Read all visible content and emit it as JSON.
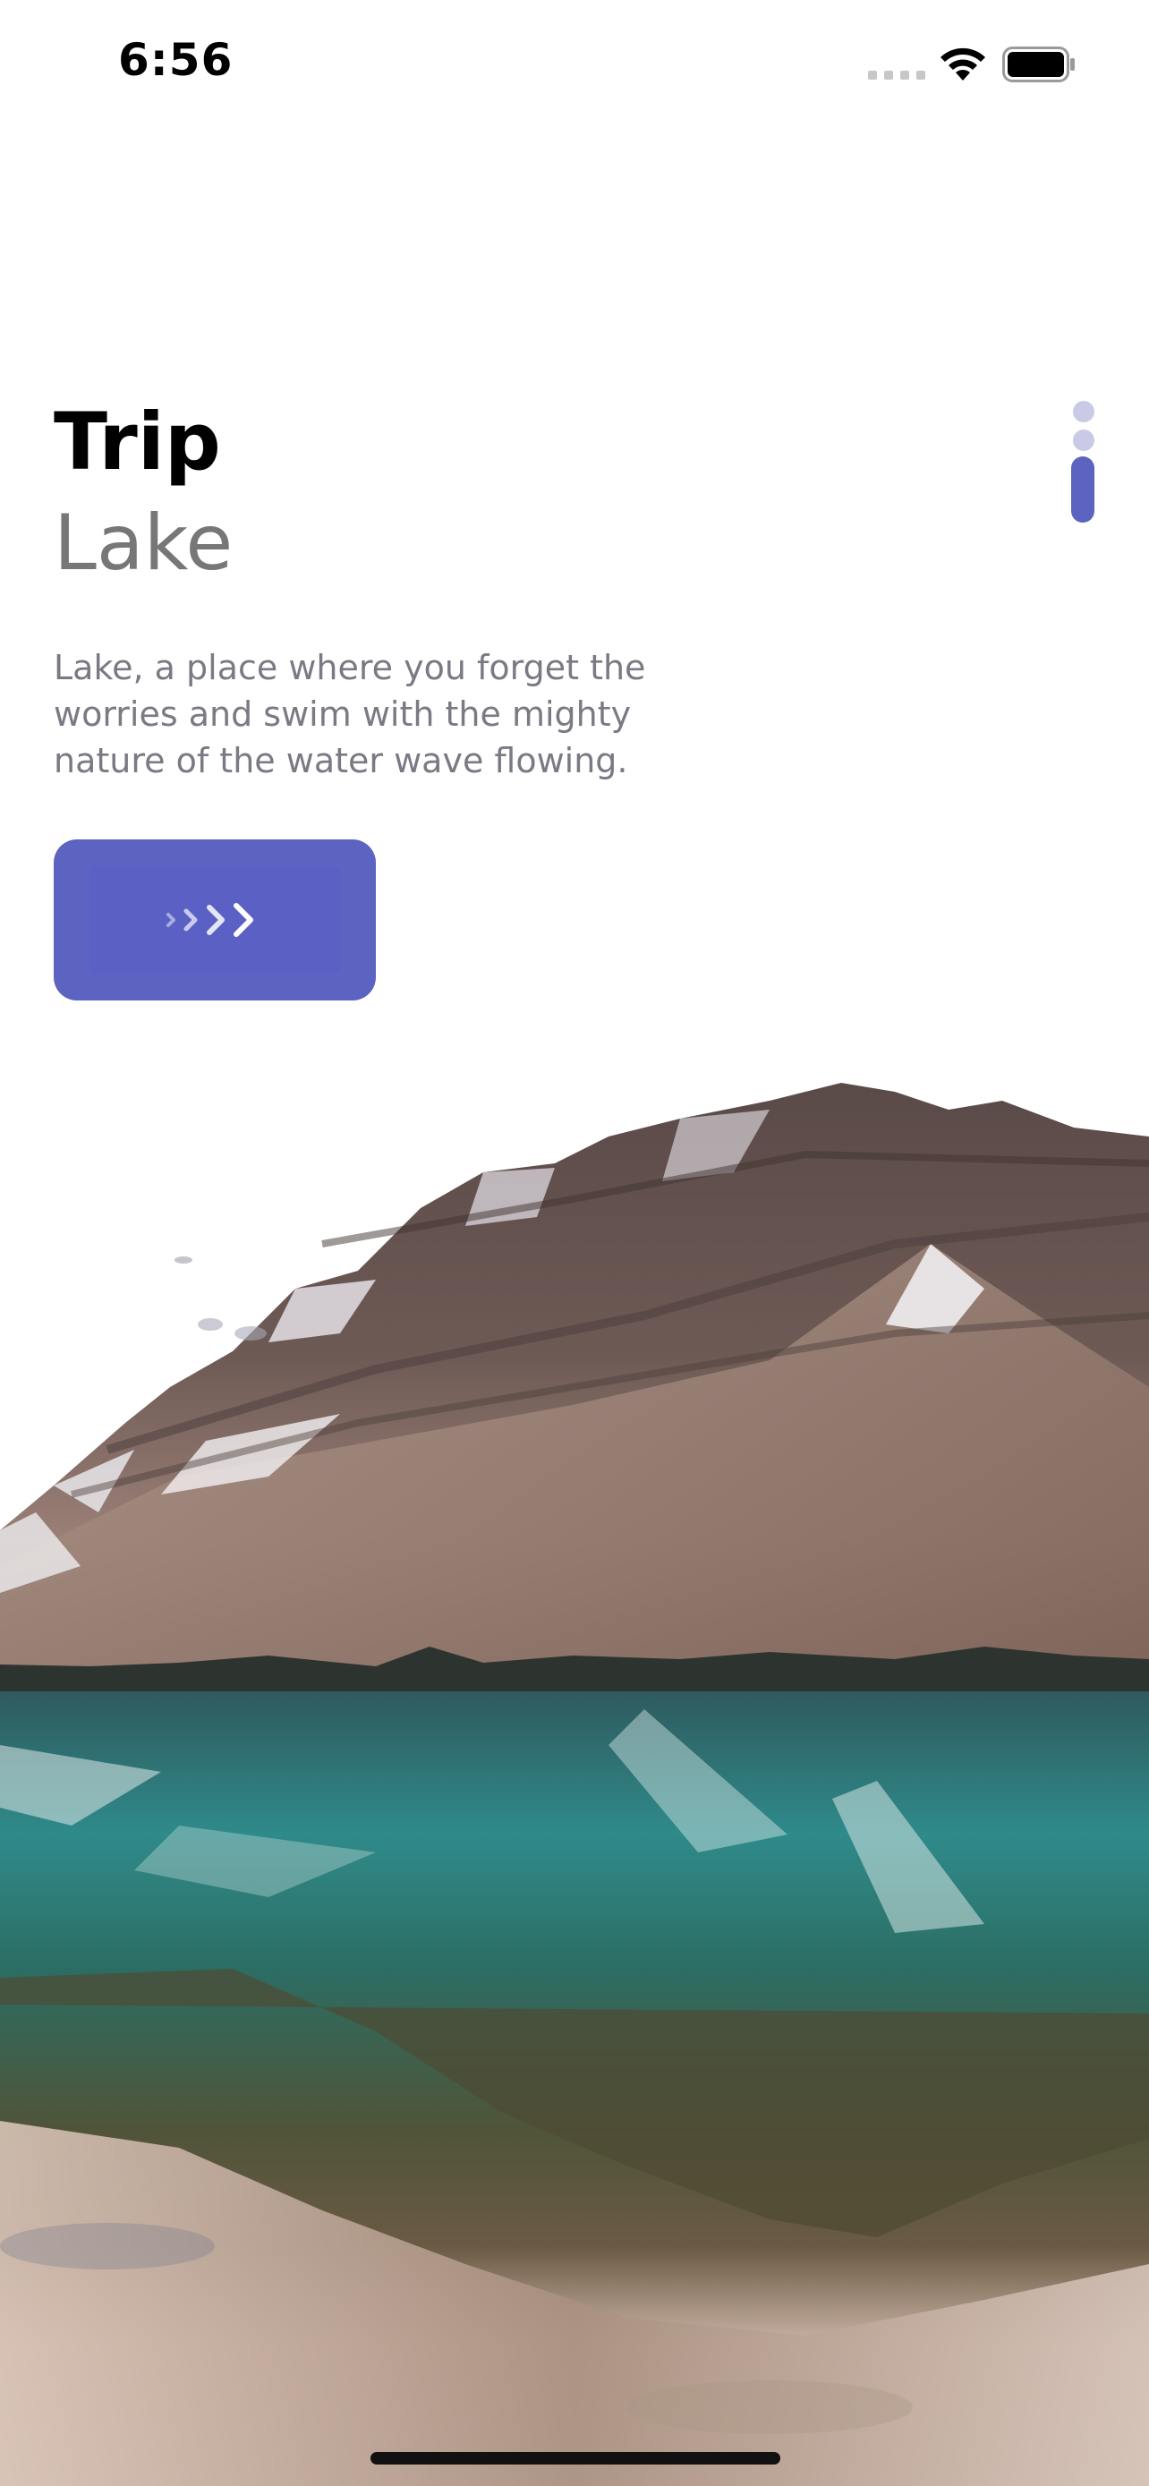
{
  "status_bar": {
    "time": "6:56"
  },
  "header": {
    "title": "Trip",
    "subtitle": "Lake"
  },
  "description": "Lake, a place where you forget the worries and swim with the mighty nature of the water wave flowing.",
  "next_button": {
    "icon": "chevrons-right-icon"
  },
  "page_indicator": {
    "page_count": 3,
    "active_index": 2
  },
  "colors": {
    "accent": "#5c63c0",
    "indicator_inactive": "#c9cbe6",
    "subtitle": "#777777",
    "description": "#7a7a85"
  },
  "background_image": {
    "icon": "mountain-lake-image"
  }
}
